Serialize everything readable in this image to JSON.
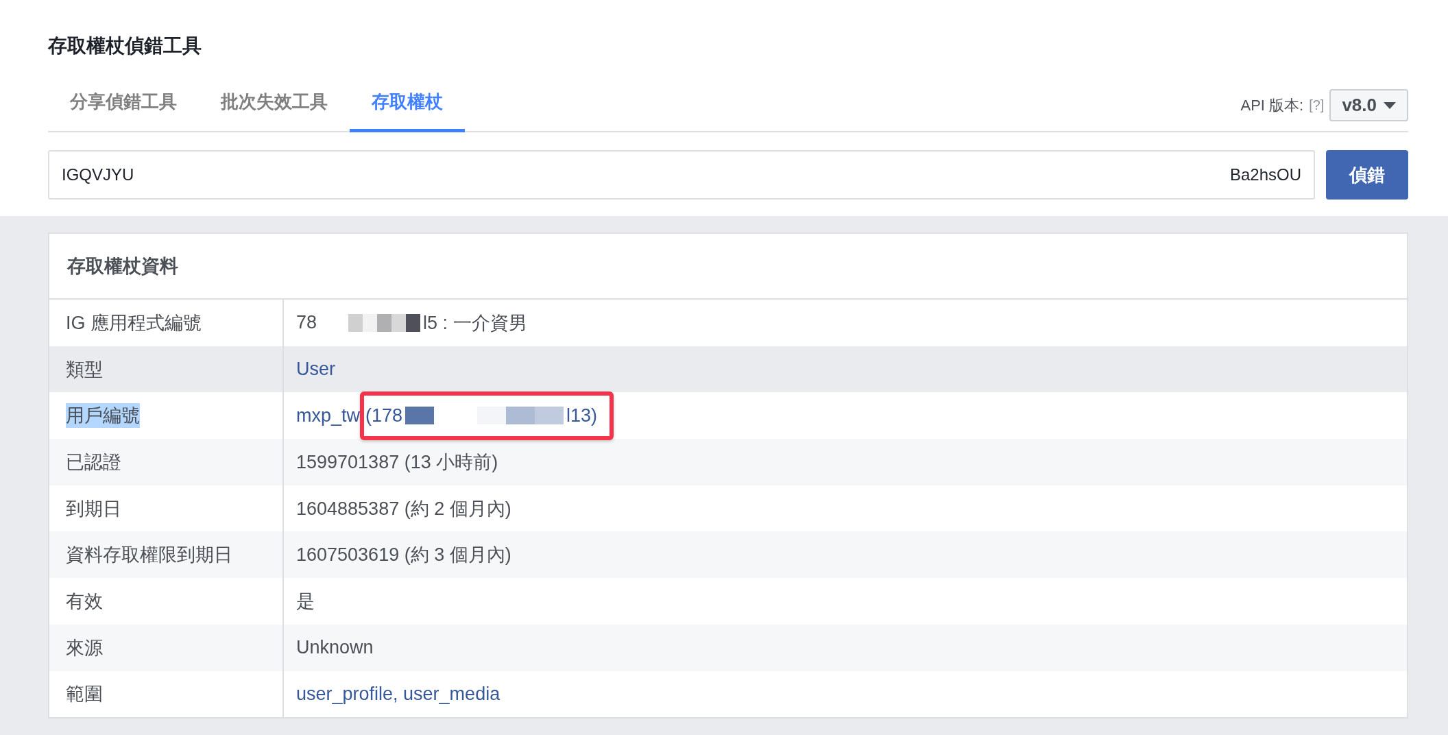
{
  "title": "存取權杖偵錯工具",
  "tabs": [
    {
      "label": "分享偵錯工具",
      "selected": false
    },
    {
      "label": "批次失效工具",
      "selected": false
    },
    {
      "label": "存取權杖",
      "selected": true
    }
  ],
  "api_version": {
    "label": "API 版本:",
    "help": "[?]",
    "value": "v8.0"
  },
  "token_field": {
    "value_start": "IGQVJYU",
    "value_end": "Ba2hsOU"
  },
  "debug_button": "偵錯",
  "panel": {
    "title": "存取權杖資料",
    "rows": [
      {
        "label": "IG 應用程式編號",
        "kind": "text",
        "value": "78",
        "value_after": "l5 : 一介資男",
        "redacted": true,
        "hovered": false,
        "label_selected": false,
        "annotated": false
      },
      {
        "label": "類型",
        "kind": "link",
        "value": "User",
        "redacted": false,
        "hovered": true,
        "label_selected": false,
        "annotated": false
      },
      {
        "label": "用戶編號",
        "kind": "link",
        "value": "mxp_tw",
        "value_boxed": "(178",
        "value_after": "l13)",
        "redacted": true,
        "hovered": false,
        "label_selected": true,
        "annotated": true
      },
      {
        "label": "已認證",
        "kind": "text",
        "value": "1599701387 (13 小時前)",
        "redacted": false,
        "hovered": false,
        "label_selected": false,
        "annotated": false
      },
      {
        "label": "到期日",
        "kind": "text",
        "value": "1604885387 (約 2 個月內)",
        "redacted": false,
        "hovered": false,
        "label_selected": false,
        "annotated": false
      },
      {
        "label": "資料存取權限到期日",
        "kind": "text",
        "value": "1607503619 (約 3 個月內)",
        "redacted": false,
        "hovered": false,
        "label_selected": false,
        "annotated": false
      },
      {
        "label": "有效",
        "kind": "text",
        "value": "是",
        "redacted": false,
        "hovered": false,
        "label_selected": false,
        "annotated": false
      },
      {
        "label": "來源",
        "kind": "text",
        "value": "Unknown",
        "redacted": false,
        "hovered": false,
        "label_selected": false,
        "annotated": false
      },
      {
        "label": "範圍",
        "kind": "link",
        "value": "user_profile, user_media",
        "redacted": false,
        "hovered": false,
        "label_selected": false,
        "annotated": false
      }
    ]
  }
}
